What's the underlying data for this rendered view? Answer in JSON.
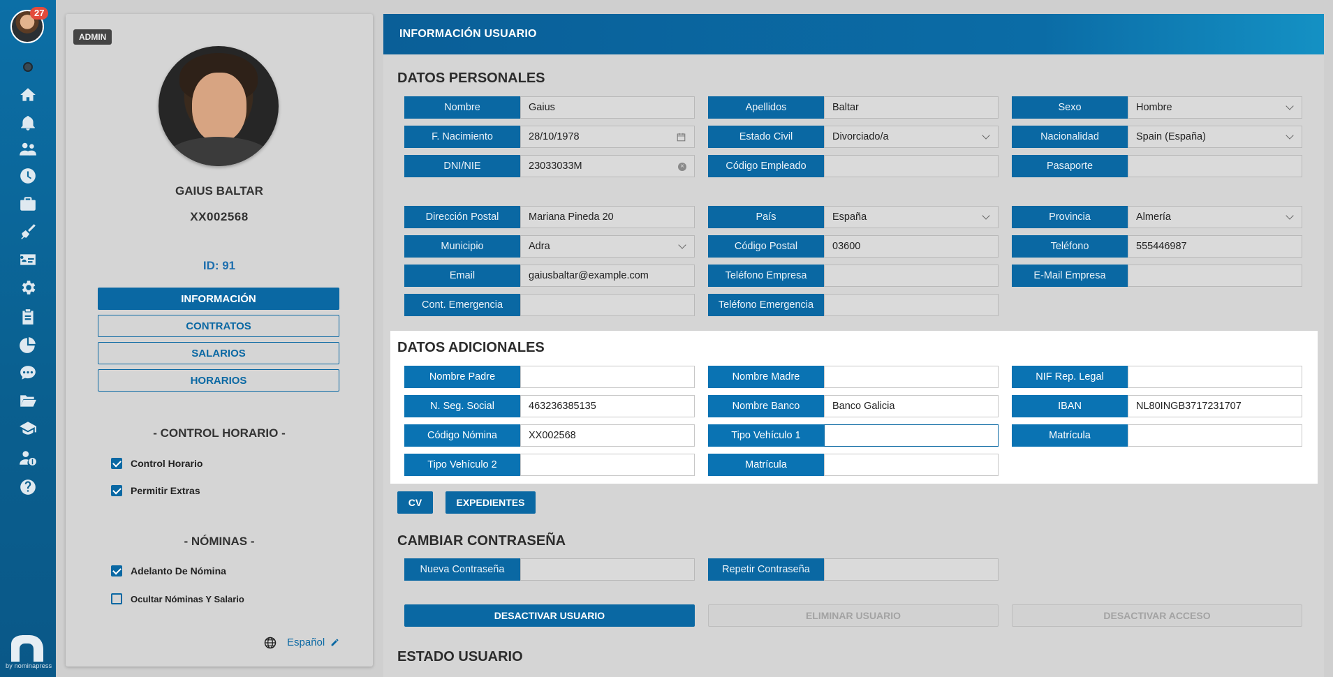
{
  "sidebar": {
    "notification_count": "27",
    "brand_text": "by nominapress",
    "icons": [
      "home-icon",
      "bell-icon",
      "users-icon",
      "clock-icon",
      "briefcase-icon",
      "broom-icon",
      "id-card-icon",
      "gear-icon",
      "clipboard-icon",
      "pie-chart-icon",
      "chat-icon",
      "folder-icon",
      "graduation-cap-icon",
      "user-money-icon",
      "help-icon"
    ]
  },
  "profile": {
    "role_badge": "ADMIN",
    "name": "GAIUS BALTAR",
    "code": "XX002568",
    "id_label": "ID: 91",
    "nav": [
      "INFORMACIÓN",
      "CONTRATOS",
      "SALARIOS",
      "HORARIOS"
    ],
    "control_horario_title": "- CONTROL HORARIO -",
    "control_horario": [
      {
        "label": "Control Horario",
        "checked": true
      },
      {
        "label": "Permitir Extras",
        "checked": true
      }
    ],
    "nominas_title": "- NÓMINAS -",
    "nominas": [
      {
        "label": "Adelanto De Nómina",
        "checked": true
      },
      {
        "label": "Ocultar Nóminas Y Salario",
        "checked": false
      }
    ],
    "language": "Español"
  },
  "main": {
    "header_title": "INFORMACIÓN USUARIO",
    "datos_personales": {
      "title": "DATOS PERSONALES",
      "fields": [
        {
          "label": "Nombre",
          "value": "Gaius"
        },
        {
          "label": "Apellidos",
          "value": "Baltar"
        },
        {
          "label": "Sexo",
          "value": "Hombre"
        },
        {
          "label": "F. Nacimiento",
          "value": "28/10/1978"
        },
        {
          "label": "Estado Civil",
          "value": "Divorciado/a"
        },
        {
          "label": "Nacionalidad",
          "value": "Spain (España)"
        },
        {
          "label": "DNI/NIE",
          "value": "23033033M"
        },
        {
          "label": "Código Empleado",
          "value": ""
        },
        {
          "label": "Pasaporte",
          "value": ""
        },
        {
          "label": "Dirección Postal",
          "value": "Mariana Pineda 20"
        },
        {
          "label": "País",
          "value": "España"
        },
        {
          "label": "Provincia",
          "value": "Almería"
        },
        {
          "label": "Municipio",
          "value": "Adra"
        },
        {
          "label": "Código Postal",
          "value": "03600"
        },
        {
          "label": "Teléfono",
          "value": "555446987"
        },
        {
          "label": "Email",
          "value": "gaiusbaltar@example.com"
        },
        {
          "label": "Teléfono Empresa",
          "value": ""
        },
        {
          "label": "E-Mail Empresa",
          "value": ""
        },
        {
          "label": "Cont. Emergencia",
          "value": ""
        },
        {
          "label": "Teléfono Emergencia",
          "value": ""
        }
      ]
    },
    "datos_adicionales": {
      "title": "DATOS ADICIONALES",
      "fields": [
        {
          "label": "Nombre Padre",
          "value": ""
        },
        {
          "label": "Nombre Madre",
          "value": ""
        },
        {
          "label": "NIF Rep. Legal",
          "value": ""
        },
        {
          "label": "N. Seg. Social",
          "value": "463236385135"
        },
        {
          "label": "Nombre Banco",
          "value": "Banco Galicia"
        },
        {
          "label": "IBAN",
          "value": "NL80INGB3717231707"
        },
        {
          "label": "Código Nómina",
          "value": "XX002568"
        },
        {
          "label": "Tipo Vehículo 1",
          "value": ""
        },
        {
          "label": "Matrícula",
          "value": ""
        },
        {
          "label": "Tipo Vehículo 2",
          "value": ""
        },
        {
          "label": "Matrícula",
          "value": ""
        }
      ]
    },
    "doc_buttons": [
      "CV",
      "EXPEDIENTES"
    ],
    "password": {
      "title": "CAMBIAR CONTRASEÑA",
      "new_label": "Nueva Contraseña",
      "repeat_label": "Repetir Contraseña"
    },
    "actions": [
      "DESACTIVAR USUARIO",
      "ELIMINAR USUARIO",
      "DESACTIVAR ACCESO"
    ],
    "estado_title": "ESTADO USUARIO"
  }
}
